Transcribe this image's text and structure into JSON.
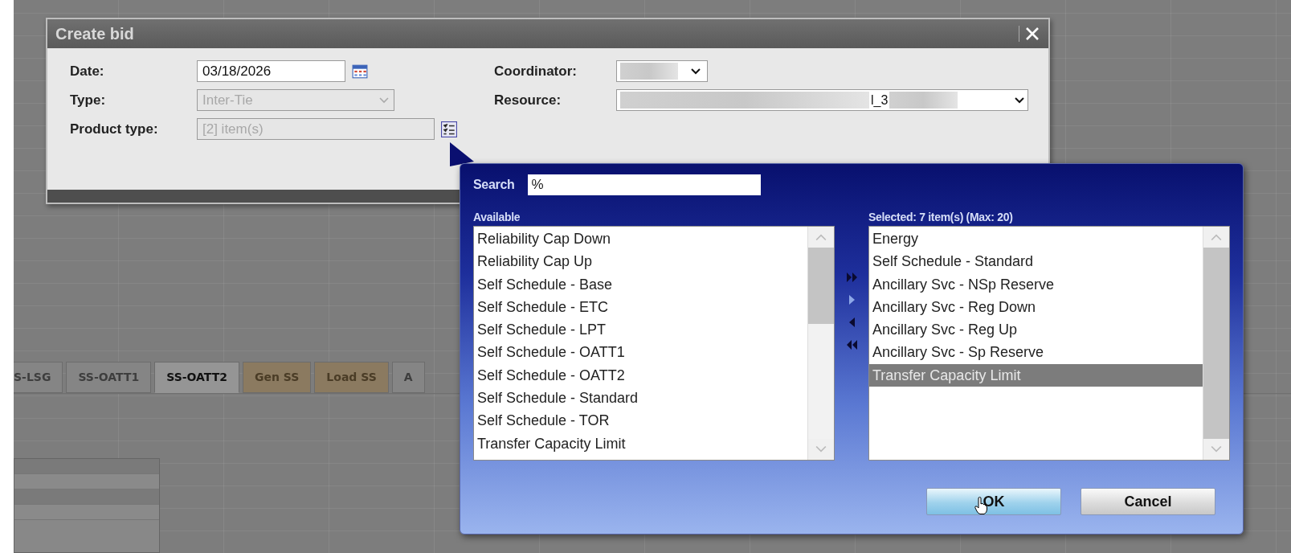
{
  "background_tabs": [
    {
      "label": "S-LSG",
      "kind": "plain",
      "selected": false
    },
    {
      "label": "SS-OATT1",
      "kind": "plain",
      "selected": false
    },
    {
      "label": "SS-OATT2",
      "kind": "plain",
      "selected": true
    },
    {
      "label": "Gen SS",
      "kind": "highlight",
      "selected": false
    },
    {
      "label": "Load SS",
      "kind": "highlight",
      "selected": false
    },
    {
      "label": "A",
      "kind": "plain",
      "selected": false
    }
  ],
  "dialog": {
    "title": "Create bid",
    "date": {
      "label": "Date:",
      "value": "03/18/2026"
    },
    "type": {
      "label": "Type:",
      "value": "Inter-Tie",
      "disabled": true
    },
    "product_type": {
      "label": "Product type:",
      "value": "[2] item(s)",
      "disabled": true
    },
    "coordinator": {
      "label": "Coordinator:"
    },
    "resource": {
      "label": "Resource:",
      "value": "l_3"
    }
  },
  "picker": {
    "search": {
      "label": "Search",
      "value": "%"
    },
    "available": {
      "label": "Available",
      "items": [
        {
          "label": "Reliability Cap Down",
          "selected": false
        },
        {
          "label": "Reliability Cap Up",
          "selected": false
        },
        {
          "label": "Self Schedule - Base",
          "selected": false
        },
        {
          "label": "Self Schedule - ETC",
          "selected": false
        },
        {
          "label": "Self Schedule - LPT",
          "selected": false
        },
        {
          "label": "Self Schedule - OATT1",
          "selected": false
        },
        {
          "label": "Self Schedule - OATT2",
          "selected": false
        },
        {
          "label": "Self Schedule - Standard",
          "selected": false
        },
        {
          "label": "Self Schedule - TOR",
          "selected": false
        },
        {
          "label": "Transfer Capacity Limit",
          "selected": false
        }
      ]
    },
    "transfer_buttons": [
      {
        "kind": "add_all",
        "disabled": false
      },
      {
        "kind": "add",
        "disabled": true
      },
      {
        "kind": "remove",
        "disabled": false
      },
      {
        "kind": "remove_all",
        "disabled": false
      }
    ],
    "chosen": {
      "label": "Selected: 7 item(s) (Max: 20)",
      "items": [
        {
          "label": "Energy",
          "selected": false
        },
        {
          "label": "Self Schedule - Standard",
          "selected": false
        },
        {
          "label": "Ancillary Svc - NSp Reserve",
          "selected": false
        },
        {
          "label": "Ancillary Svc - Reg Down",
          "selected": false
        },
        {
          "label": "Ancillary Svc - Reg Up",
          "selected": false
        },
        {
          "label": "Ancillary Svc - Sp Reserve",
          "selected": false
        },
        {
          "label": "Transfer Capacity Limit",
          "selected": true
        }
      ]
    },
    "buttons": [
      {
        "label": "OK",
        "kind": "primary"
      },
      {
        "label": "Cancel",
        "kind": "secondary"
      }
    ]
  }
}
